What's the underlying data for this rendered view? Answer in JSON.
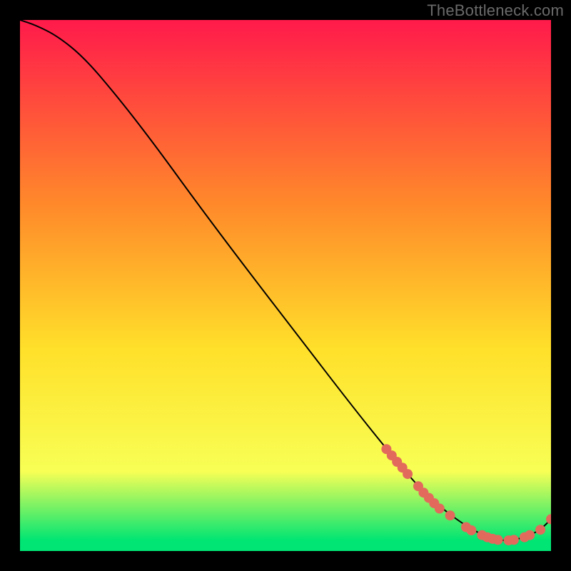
{
  "watermark": "TheBottleneck.com",
  "chart_data": {
    "type": "line",
    "title": "",
    "xlabel": "",
    "ylabel": "",
    "xlim": [
      0,
      100
    ],
    "ylim": [
      0,
      100
    ],
    "grid": false,
    "background_gradient": {
      "top": "#ff1a4b",
      "mid1": "#ff8a2a",
      "mid2": "#ffe02a",
      "low": "#f8ff55",
      "bottom": "#00e573"
    },
    "curve": [
      {
        "x": 0,
        "y": 100
      },
      {
        "x": 3,
        "y": 99
      },
      {
        "x": 7,
        "y": 97
      },
      {
        "x": 12,
        "y": 93
      },
      {
        "x": 18,
        "y": 86
      },
      {
        "x": 25,
        "y": 77
      },
      {
        "x": 33,
        "y": 66
      },
      {
        "x": 42,
        "y": 54
      },
      {
        "x": 52,
        "y": 41
      },
      {
        "x": 62,
        "y": 28
      },
      {
        "x": 70,
        "y": 18
      },
      {
        "x": 76,
        "y": 11
      },
      {
        "x": 82,
        "y": 6
      },
      {
        "x": 87,
        "y": 3
      },
      {
        "x": 90,
        "y": 2
      },
      {
        "x": 93,
        "y": 2
      },
      {
        "x": 96,
        "y": 3
      },
      {
        "x": 98,
        "y": 4
      },
      {
        "x": 100,
        "y": 6
      }
    ],
    "marker_color": "#e26a5c",
    "markers": [
      {
        "x": 69,
        "y": 19.2
      },
      {
        "x": 70,
        "y": 18.0
      },
      {
        "x": 71,
        "y": 16.8
      },
      {
        "x": 72,
        "y": 15.7
      },
      {
        "x": 73,
        "y": 14.5
      },
      {
        "x": 75,
        "y": 12.2
      },
      {
        "x": 76,
        "y": 11.0
      },
      {
        "x": 77,
        "y": 10.0
      },
      {
        "x": 78,
        "y": 9.0
      },
      {
        "x": 79,
        "y": 8.0
      },
      {
        "x": 81,
        "y": 6.7
      },
      {
        "x": 84,
        "y": 4.5
      },
      {
        "x": 85,
        "y": 3.9
      },
      {
        "x": 87,
        "y": 3.0
      },
      {
        "x": 88,
        "y": 2.6
      },
      {
        "x": 89,
        "y": 2.3
      },
      {
        "x": 90,
        "y": 2.1
      },
      {
        "x": 92,
        "y": 2.0
      },
      {
        "x": 93,
        "y": 2.1
      },
      {
        "x": 95,
        "y": 2.6
      },
      {
        "x": 96,
        "y": 3.0
      },
      {
        "x": 98,
        "y": 4.0
      },
      {
        "x": 100,
        "y": 6.0
      }
    ]
  }
}
